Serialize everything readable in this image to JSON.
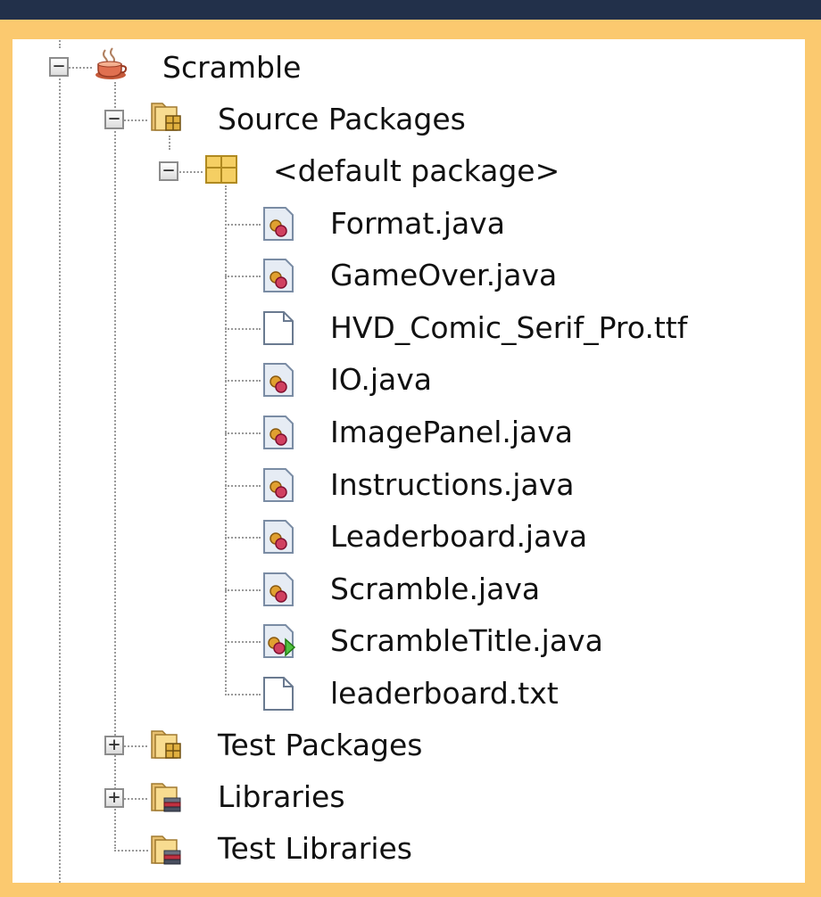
{
  "tree": {
    "project": {
      "label": "Scramble",
      "icon": "coffee-cup-icon",
      "expanded": true
    },
    "source_packages": {
      "label": "Source Packages",
      "icon": "source-package-folder-icon",
      "expanded": true
    },
    "default_package": {
      "label": "<default package>",
      "icon": "package-icon",
      "expanded": true
    },
    "files": [
      {
        "label": "Format.java",
        "icon": "java-class-icon"
      },
      {
        "label": "GameOver.java",
        "icon": "java-class-icon"
      },
      {
        "label": "HVD_Comic_Serif_Pro.ttf",
        "icon": "file-icon"
      },
      {
        "label": "IO.java",
        "icon": "java-class-icon"
      },
      {
        "label": "ImagePanel.java",
        "icon": "java-class-icon"
      },
      {
        "label": "Instructions.java",
        "icon": "java-class-icon"
      },
      {
        "label": "Leaderboard.java",
        "icon": "java-class-icon"
      },
      {
        "label": "Scramble.java",
        "icon": "java-class-icon"
      },
      {
        "label": "ScrambleTitle.java",
        "icon": "java-main-class-icon"
      },
      {
        "label": "leaderboard.txt",
        "icon": "file-icon"
      }
    ],
    "test_packages": {
      "label": "Test Packages",
      "icon": "test-package-folder-icon",
      "expanded": false
    },
    "libraries": {
      "label": "Libraries",
      "icon": "library-folder-icon",
      "expanded": false
    },
    "test_libraries": {
      "label": "Test Libraries",
      "icon": "library-folder-icon"
    },
    "expand_symbol": "+",
    "collapse_symbol": "−"
  },
  "colors": {
    "outer_background": "#22304a",
    "border": "#fbc96f",
    "tree_background": "#ffffff",
    "text": "#111111"
  }
}
